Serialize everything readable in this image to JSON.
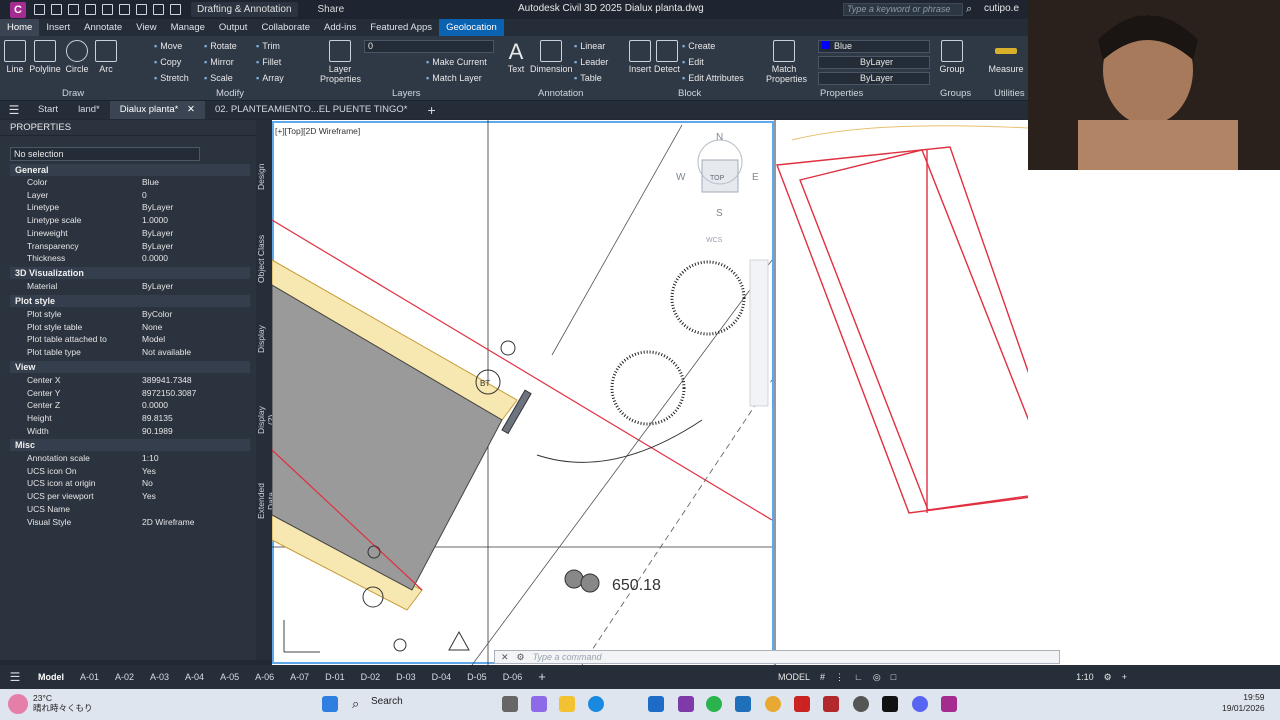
{
  "titlebar": {
    "logo": "C",
    "workspace": "Drafting & Annotation",
    "share": "Share",
    "title": "Autodesk Civil 3D 2025   Dialux planta.dwg",
    "search_placeholder": "Type a keyword or phrase",
    "user": "cutipo.e"
  },
  "ribbon_tabs": [
    "Home",
    "Insert",
    "Annotate",
    "View",
    "Manage",
    "Output",
    "Collaborate",
    "Add-ins",
    "Featured Apps",
    "Geolocation"
  ],
  "ribbon": {
    "draw": {
      "label": "Draw",
      "line": "Line",
      "polyline": "Polyline",
      "circle": "Circle",
      "arc": "Arc"
    },
    "modify": {
      "label": "Modify",
      "move": "Move",
      "rotate": "Rotate",
      "trim": "Trim",
      "copy": "Copy",
      "mirror": "Mirror",
      "fillet": "Fillet",
      "stretch": "Stretch",
      "scale": "Scale",
      "array": "Array"
    },
    "layers": {
      "label": "Layers",
      "layer_properties": "Layer Properties",
      "layer_value": "0",
      "make_current": "Make Current",
      "match_layer": "Match Layer"
    },
    "annotation": {
      "label": "Annotation",
      "text": "Text",
      "dimension": "Dimension",
      "linear": "Linear",
      "leader": "Leader",
      "table": "Table"
    },
    "block": {
      "label": "Block",
      "insert": "Insert",
      "detect": "Detect",
      "create": "Create",
      "edit": "Edit",
      "edit_attributes": "Edit Attributes"
    },
    "properties": {
      "label": "Properties",
      "match_properties": "Match Properties",
      "color": "Blue",
      "linetype": "ByLayer",
      "lineweight": "ByLayer"
    },
    "groups": {
      "label": "Groups",
      "group": "Group"
    },
    "utilities": {
      "label": "Utilities",
      "measure": "Measure"
    }
  },
  "doc_tabs": [
    "Start",
    "land*",
    "Dialux planta*",
    "02. PLANTEAMIENTO...EL PUENTE TINGO*"
  ],
  "properties": {
    "title": "PROPERTIES",
    "selection": "No selection",
    "sections": {
      "general": "General",
      "visualization": "3D Visualization",
      "plot": "Plot style",
      "view": "View",
      "misc": "Misc"
    },
    "general_rows": [
      {
        "k": "Color",
        "v": "Blue"
      },
      {
        "k": "Layer",
        "v": "0"
      },
      {
        "k": "Linetype",
        "v": "ByLayer"
      },
      {
        "k": "Linetype scale",
        "v": "1.0000"
      },
      {
        "k": "Lineweight",
        "v": "ByLayer"
      },
      {
        "k": "Transparency",
        "v": "ByLayer"
      },
      {
        "k": "Thickness",
        "v": "0.0000"
      }
    ],
    "visualization_rows": [
      {
        "k": "Material",
        "v": "ByLayer"
      }
    ],
    "plot_rows": [
      {
        "k": "Plot style",
        "v": "ByColor"
      },
      {
        "k": "Plot style table",
        "v": "None"
      },
      {
        "k": "Plot table attached to",
        "v": "Model"
      },
      {
        "k": "Plot table type",
        "v": "Not available"
      }
    ],
    "view_rows": [
      {
        "k": "Center X",
        "v": "389941.7348"
      },
      {
        "k": "Center Y",
        "v": "8972150.3087"
      },
      {
        "k": "Center Z",
        "v": "0.0000"
      },
      {
        "k": "Height",
        "v": "89.8135"
      },
      {
        "k": "Width",
        "v": "90.1989"
      }
    ],
    "misc_rows": [
      {
        "k": "Annotation scale",
        "v": "1:10"
      },
      {
        "k": "UCS icon On",
        "v": "Yes"
      },
      {
        "k": "UCS icon at origin",
        "v": "No"
      },
      {
        "k": "UCS per viewport",
        "v": "Yes"
      },
      {
        "k": "UCS Name",
        "v": ""
      },
      {
        "k": "Visual Style",
        "v": "2D Wireframe"
      }
    ]
  },
  "side_tabs": [
    "Design",
    "Object Class",
    "Display",
    "Display (2)",
    "Extended Data"
  ],
  "viewport": {
    "label": "[+][Top][2D Wireframe]",
    "viewcube_top": "TOP",
    "compass_n": "N",
    "compass_w": "W",
    "compass_e": "E",
    "compass_s": "S",
    "wcs": "WCS",
    "elevation": "650.18",
    "bt_label": "BT"
  },
  "command": {
    "placeholder": "Type a command"
  },
  "layout_tabs": [
    "Model",
    "A-01",
    "A-02",
    "A-03",
    "A-04",
    "A-05",
    "A-06",
    "A-07",
    "D-01",
    "D-02",
    "D-03",
    "D-04",
    "D-05",
    "D-06"
  ],
  "status": {
    "model": "MODEL",
    "scale": "1:10"
  },
  "taskbar": {
    "temperature": "23°C",
    "weather": "晴れ時々くもり",
    "search": "Search",
    "time": "19:59",
    "date": "19/01/2026"
  }
}
